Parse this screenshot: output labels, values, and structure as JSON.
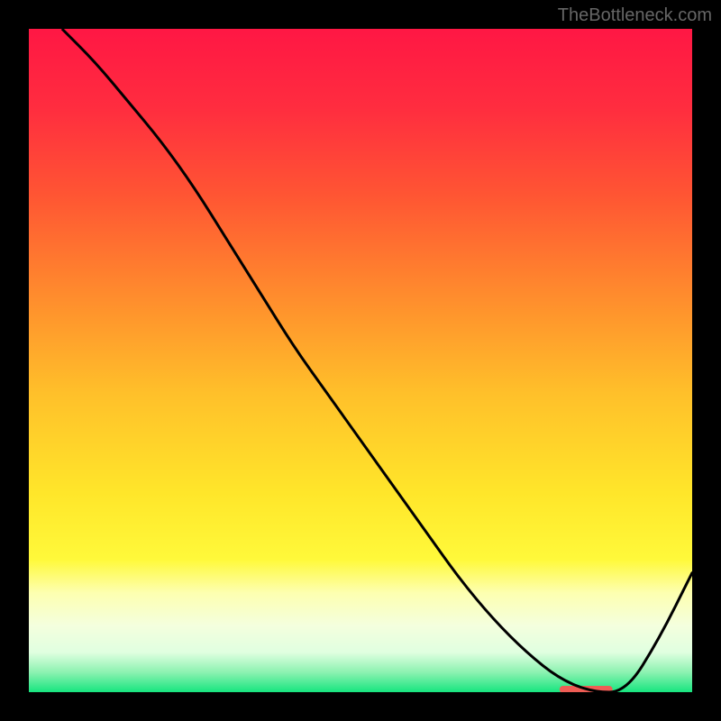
{
  "watermark": "TheBottleneck.com",
  "chart_data": {
    "type": "line",
    "title": "",
    "xlabel": "",
    "ylabel": "",
    "xlim": [
      0,
      100
    ],
    "ylim": [
      0,
      100
    ],
    "background": {
      "type": "vertical-gradient",
      "stops": [
        {
          "offset": 0.0,
          "color": "#ff1744"
        },
        {
          "offset": 0.12,
          "color": "#ff2d3f"
        },
        {
          "offset": 0.25,
          "color": "#ff5533"
        },
        {
          "offset": 0.4,
          "color": "#ff8b2d"
        },
        {
          "offset": 0.55,
          "color": "#ffc02a"
        },
        {
          "offset": 0.7,
          "color": "#ffe62a"
        },
        {
          "offset": 0.8,
          "color": "#fff93a"
        },
        {
          "offset": 0.85,
          "color": "#fdffb0"
        },
        {
          "offset": 0.9,
          "color": "#f4ffde"
        },
        {
          "offset": 0.94,
          "color": "#e0ffe0"
        },
        {
          "offset": 0.97,
          "color": "#8cf2b1"
        },
        {
          "offset": 1.0,
          "color": "#17e57f"
        }
      ]
    },
    "series": [
      {
        "name": "bottleneck-curve",
        "color": "#000000",
        "x": [
          5,
          10,
          15,
          20,
          25,
          30,
          35,
          40,
          45,
          50,
          55,
          60,
          65,
          70,
          75,
          80,
          85,
          90,
          95,
          100
        ],
        "y": [
          100,
          95,
          89,
          83,
          76,
          68,
          60,
          52,
          45,
          38,
          31,
          24,
          17,
          11,
          6,
          2,
          0,
          0,
          8,
          18
        ]
      }
    ],
    "marker": {
      "name": "highlight-zone",
      "color": "#ef5d55",
      "x_start": 80,
      "x_end": 88,
      "y": 0
    }
  }
}
